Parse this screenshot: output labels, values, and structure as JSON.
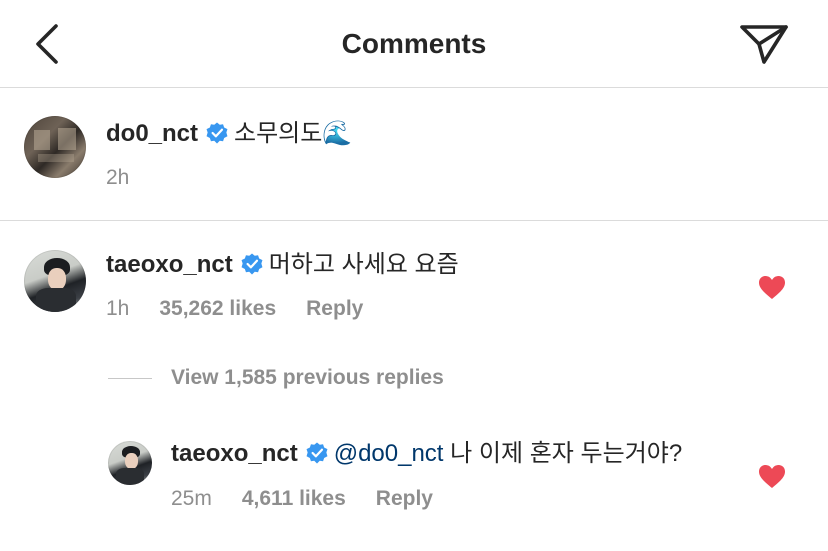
{
  "header": {
    "title": "Comments",
    "back_icon": "chevron-left-icon",
    "share_icon": "paper-plane-icon"
  },
  "caption": {
    "username": "do0_nct",
    "text": "소무의도🌊",
    "time": "2h"
  },
  "comments": [
    {
      "username": "taeoxo_nct",
      "text": "머하고 사세요 요즘",
      "time": "1h",
      "likes": "35,262 likes",
      "reply_label": "Reply",
      "liked": true
    }
  ],
  "view_replies_label": "View 1,585 previous replies",
  "reply": {
    "username": "taeoxo_nct",
    "mention": "@do0_nct",
    "text": "나 이제 혼자 두는거야?",
    "time": "25m",
    "likes": "4,611 likes",
    "reply_label": "Reply",
    "liked": true
  },
  "colors": {
    "verified": "#3897f0",
    "heart": "#ed4956",
    "secondary_text": "#8e8e8e",
    "mention": "#00376b",
    "divider": "#dbdbdb"
  }
}
